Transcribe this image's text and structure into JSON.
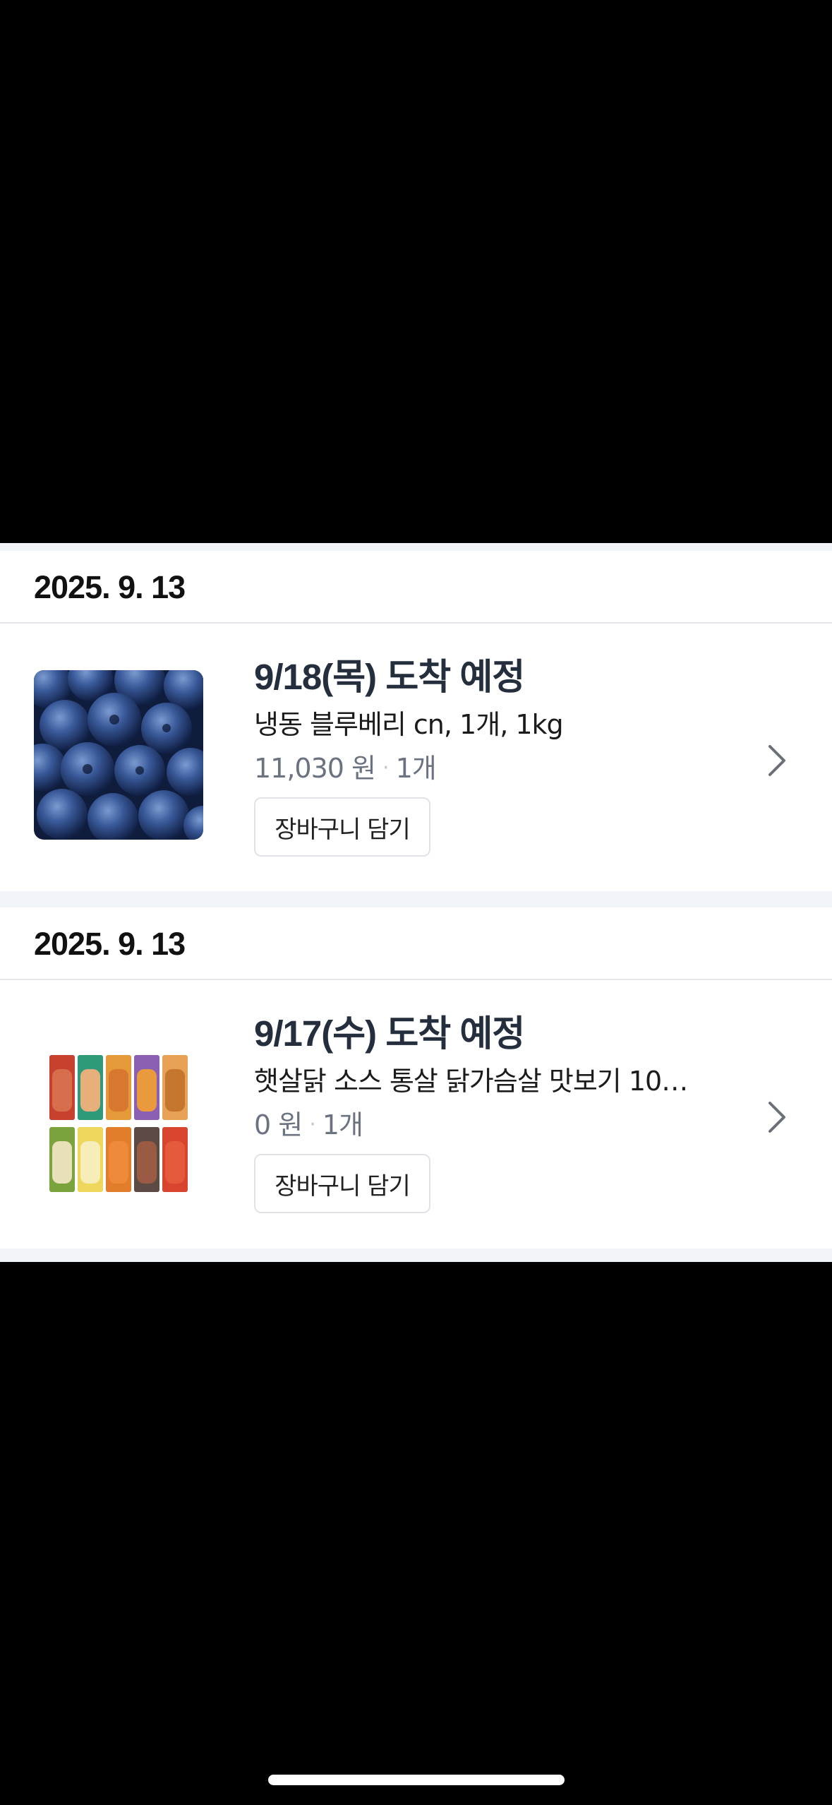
{
  "orders": [
    {
      "order_date": "2025. 9. 13",
      "arrival": "9/18(목) 도착 예정",
      "product_name": "냉동 블루베리 cn, 1개, 1kg",
      "price": "11,030 원",
      "quantity": "1개",
      "cart_button_label": "장바구니 담기",
      "thumbnail_icon": "blueberry-product-image"
    },
    {
      "order_date": "2025. 9. 13",
      "arrival": "9/17(수) 도착 예정",
      "product_name": "햇살닭 소스 통살 닭가슴살 맛보기 10…",
      "price": "0 원",
      "quantity": "1개",
      "cart_button_label": "장바구니 담기",
      "thumbnail_icon": "chicken-breast-product-image"
    }
  ],
  "separator": "·",
  "colors": {
    "arrival_text": "#242e3d",
    "muted_text": "#6b7380",
    "section_gap": "#f1f4f8",
    "divider": "#e3e6ea"
  }
}
